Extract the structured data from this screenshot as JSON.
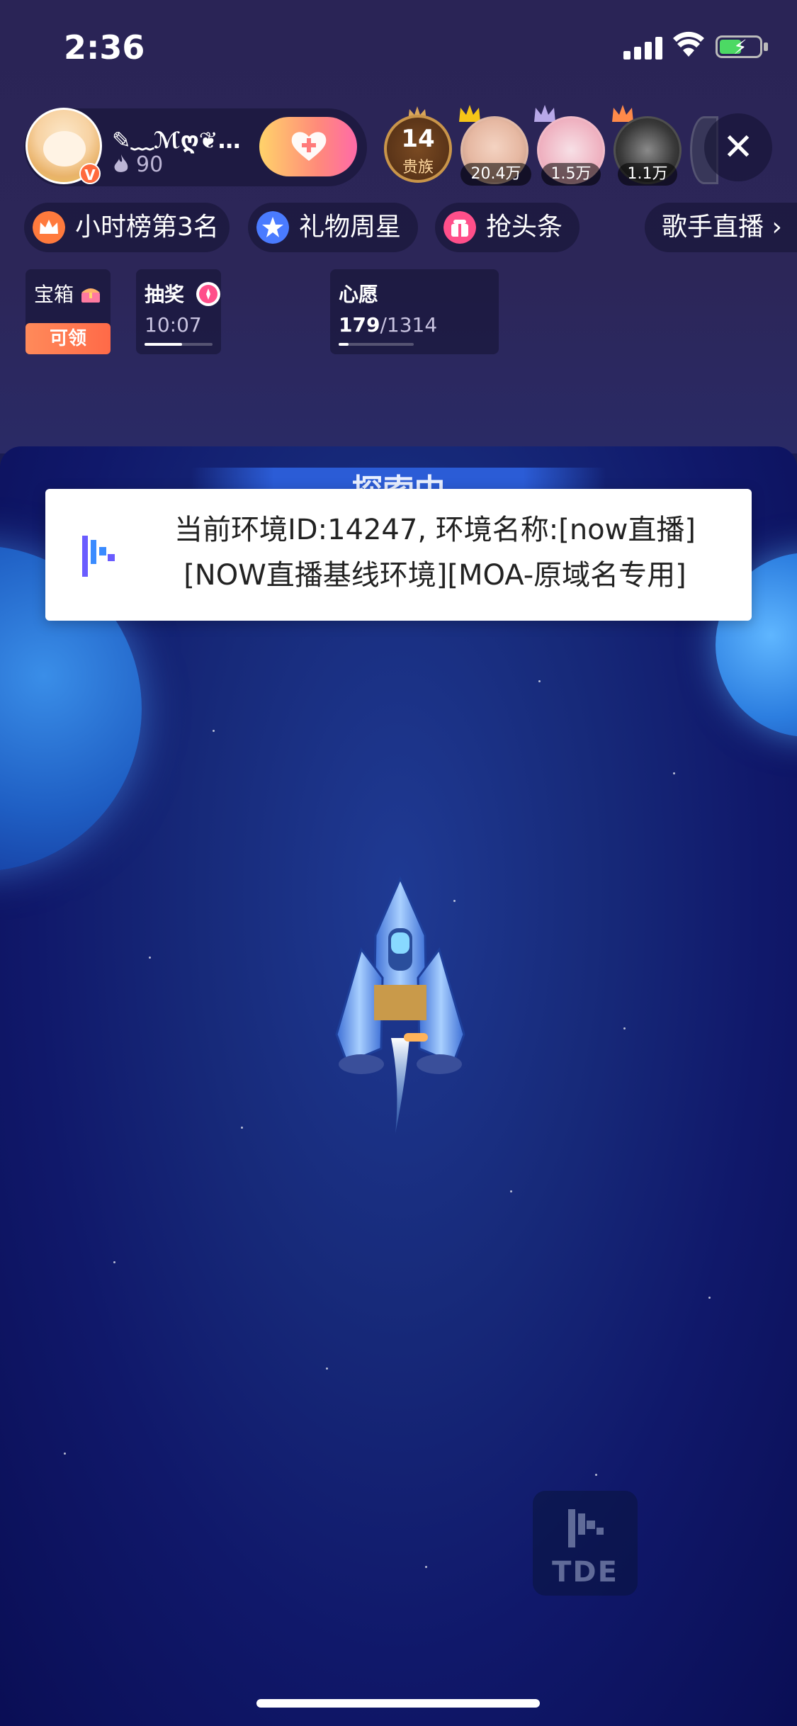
{
  "status_bar": {
    "time": "2:36"
  },
  "host": {
    "name": "✎﹏ℳღ❦…",
    "heat": "90",
    "badge": "V"
  },
  "viewers": {
    "noble_count": "14",
    "noble_label": "贵族",
    "list": [
      {
        "count": "20.4万"
      },
      {
        "count": "1.5万"
      },
      {
        "count": "1.1万"
      }
    ]
  },
  "chips": {
    "rank": "小时榜第3名",
    "gift_star": "礼物周星",
    "headline": "抢头条",
    "category": "歌手直播 ›"
  },
  "cards": {
    "chest": {
      "title": "宝箱",
      "action": "可领"
    },
    "lottery": {
      "title": "抽奖",
      "time": "10:07"
    },
    "wish": {
      "title": "心愿",
      "current": "179",
      "total": "/1314",
      "progress": 0.136
    }
  },
  "game": {
    "status_text": "探索中"
  },
  "toast": {
    "text": "当前环境ID:14247, 环境名称:[now直播][NOW直播基线环境][MOA-原域名专用]"
  },
  "tde_badge": {
    "label": "TDE"
  },
  "colors": {
    "accent_orange": "#ff6a48",
    "follow_gradient_end": "#ff6aa8",
    "toast_bg": "#ffffff"
  }
}
